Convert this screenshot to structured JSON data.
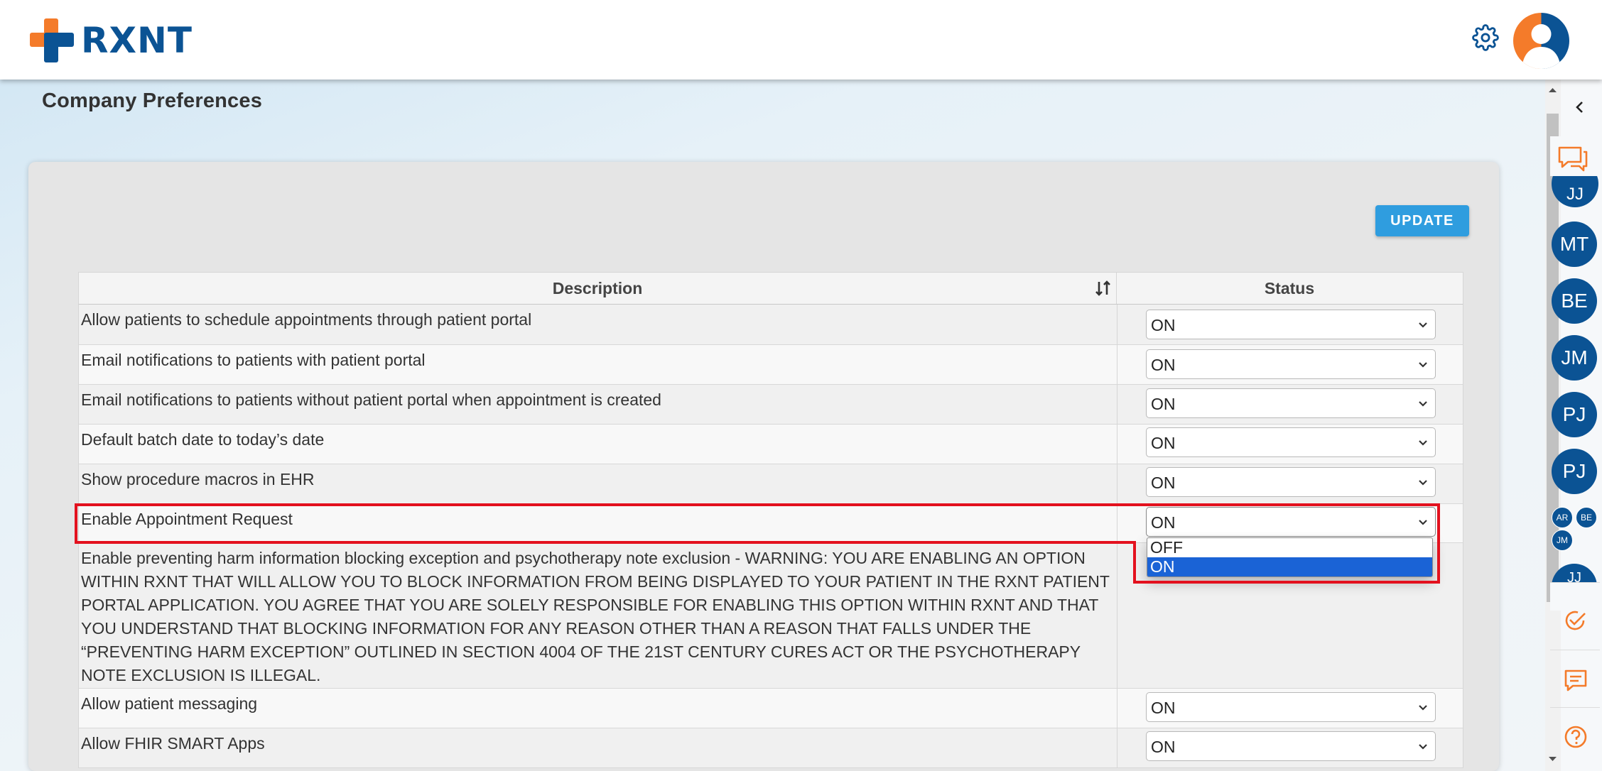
{
  "header": {
    "logo_text": "RXNT",
    "brand_colors": {
      "orange": "#f47b2a",
      "blue": "#0b5394"
    },
    "settings_icon": "gear-icon",
    "avatar_icon": "user-avatar-icon"
  },
  "page": {
    "title": "Company Preferences",
    "update_label": "UPDATE"
  },
  "table": {
    "headers": {
      "description": "Description",
      "status": "Status"
    },
    "rows": [
      {
        "description": "Allow patients to schedule appointments through patient portal",
        "status": "ON"
      },
      {
        "description": "Email notifications to patients with patient portal",
        "status": "ON"
      },
      {
        "description": "Email notifications to patients without patient portal when appointment is created",
        "status": "ON"
      },
      {
        "description": "Default batch date to today’s date",
        "status": "ON"
      },
      {
        "description": "Show procedure macros in EHR",
        "status": "ON"
      },
      {
        "description": "Enable Appointment Request",
        "status": "ON"
      },
      {
        "description": "Enable preventing harm information blocking exception and psychotherapy note exclusion - WARNING: YOU ARE ENABLING AN OPTION WITHIN RXNT THAT WILL ALLOW YOU TO BLOCK INFORMATION FROM BEING DISPLAYED TO YOUR PATIENT IN THE RXNT PATIENT PORTAL APPLICATION. YOU AGREE THAT YOU ARE SOLELY RESPONSIBLE FOR ENABLING THIS OPTION WITHIN RXNT AND THAT YOU UNDERSTAND THAT BLOCKING INFORMATION FOR ANY REASON OTHER THAN A REASON THAT FALLS UNDER THE “PREVENTING HARM EXCEPTION” OUTLINED IN SECTION 4004 OF THE 21ST CENTURY CURES ACT OR THE PSYCHOTHERAPY NOTE EXCLUSION IS ILLEGAL.",
        "status": ""
      },
      {
        "description": "Allow patient messaging",
        "status": "ON"
      },
      {
        "description": "Allow FHIR SMART Apps",
        "status": "ON"
      }
    ],
    "open_dropdown_options": [
      "OFF",
      "ON"
    ],
    "open_dropdown_selected": "ON"
  },
  "sidebar": {
    "collapse_icon": "chevron-left-icon",
    "chat_icon": "chat-bubbles-icon",
    "contacts": [
      "JJ",
      "MT",
      "BE",
      "JM",
      "PJ",
      "PJ"
    ],
    "small_contacts": [
      "AR",
      "BE",
      "JM"
    ],
    "partial_contact": "JJ",
    "tasks_icon": "check-circle-icon",
    "messages_icon": "message-icon",
    "help_icon": "help-icon",
    "accent_color": "#f47b2a"
  }
}
